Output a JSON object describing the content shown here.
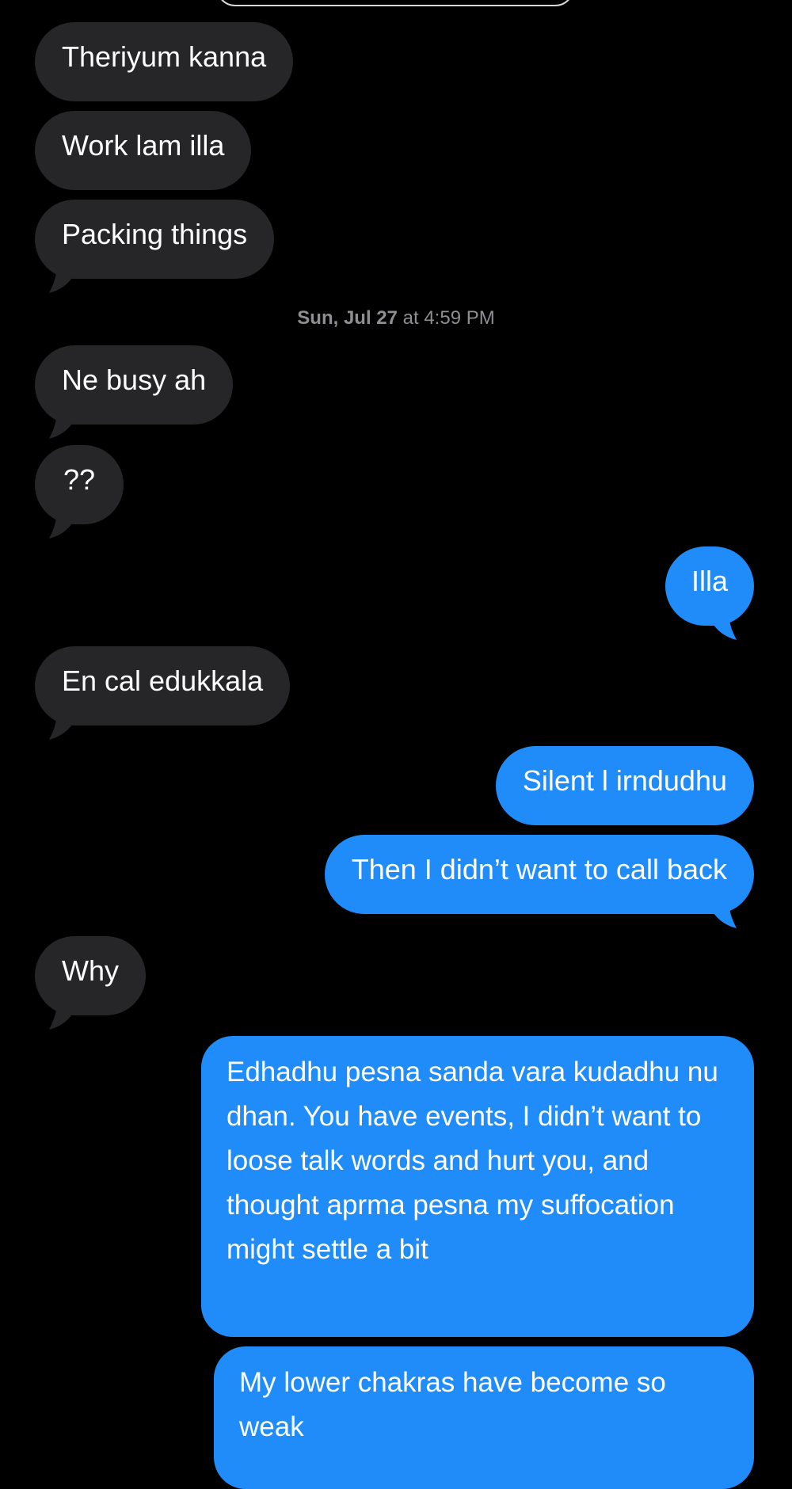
{
  "timestamp": {
    "date": "Sun, Jul 27",
    "at_time": " at 4:59 PM"
  },
  "messages": [
    {
      "from": "them",
      "text": "Theriyum kanna"
    },
    {
      "from": "them",
      "text": "Work lam illa"
    },
    {
      "from": "them",
      "text": "Packing things"
    },
    {
      "from": "them",
      "text": "Ne busy ah"
    },
    {
      "from": "them",
      "text": "??"
    },
    {
      "from": "me",
      "text": "Illa"
    },
    {
      "from": "them",
      "text": "En cal edukkala"
    },
    {
      "from": "me",
      "text": "Silent l irndudhu"
    },
    {
      "from": "me",
      "text": "Then I didn’t want to call back"
    },
    {
      "from": "them",
      "text": "Why"
    },
    {
      "from": "me",
      "text": "Edhadhu pesna sanda vara kudadhu nu dhan. You have events, I didn’t want to loose talk words and hurt you, and thought aprma pesna my suffocation might settle a bit"
    },
    {
      "from": "me",
      "text": "My lower chakras have become so weak"
    }
  ],
  "colors": {
    "incoming_bubble": "#262628",
    "outgoing_bubble": "#1f8cf9",
    "background": "#000000",
    "timestamp_text": "#8e8e93"
  }
}
